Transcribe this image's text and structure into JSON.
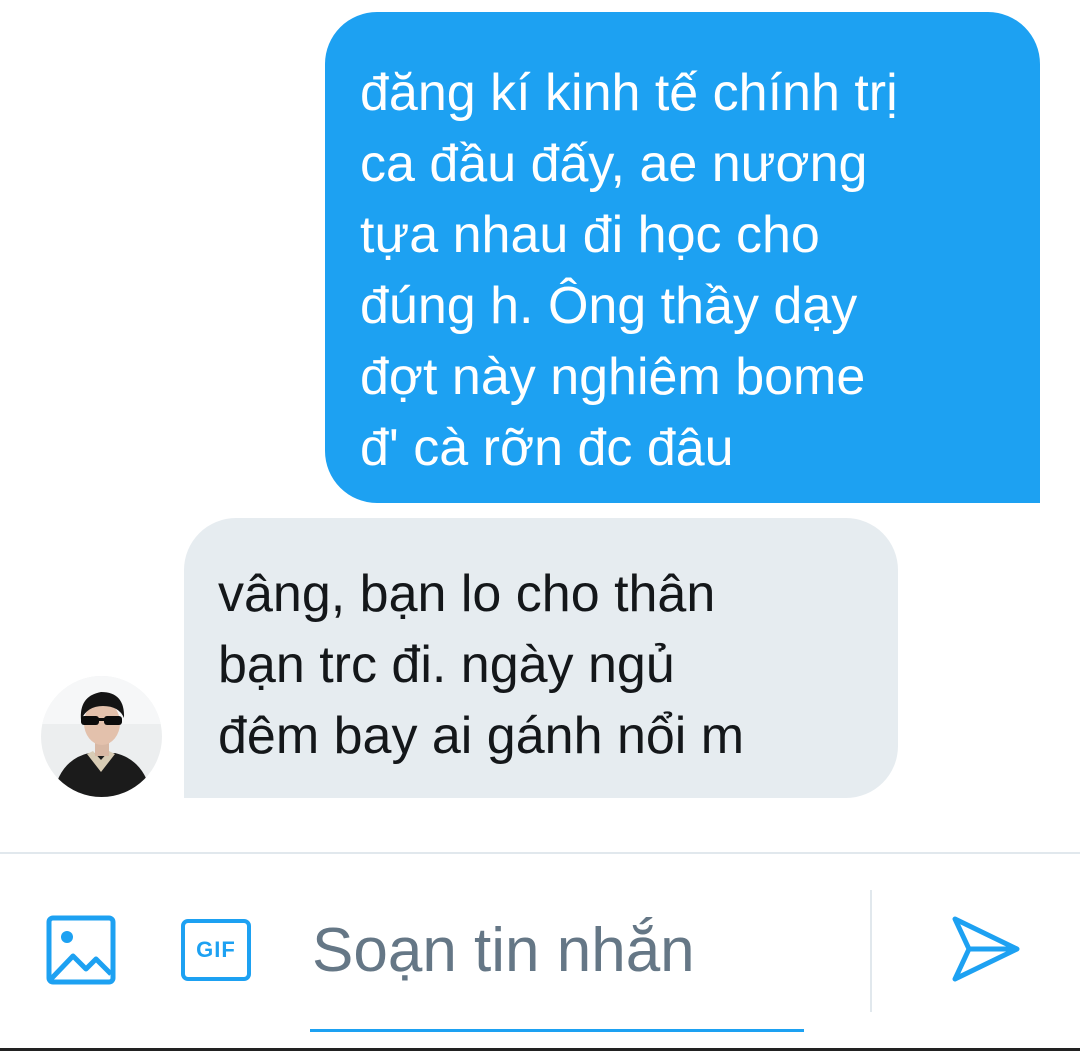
{
  "conversation": {
    "messages": [
      {
        "direction": "outgoing",
        "text": "đăng kí kinh tế chính trị\nca đầu đấy, ae nương\ntựa nhau đi học cho\nđúng h. Ông thầy dạy\nđợt này nghiêm bome\nđ' cà rỡn đc đâu"
      },
      {
        "direction": "incoming",
        "text": "vâng, bạn lo cho thân\nbạn trc đi. ngày ngủ\nđêm bay ai gánh nổi m"
      }
    ]
  },
  "composer": {
    "placeholder": "Soạn tin nhắn",
    "value": "",
    "gif_label": "GIF",
    "icons": {
      "image": "image-icon",
      "gif": "gif-icon",
      "send": "send-icon"
    }
  },
  "colors": {
    "accent": "#1da1f2",
    "incoming_bubble": "#e6ecf0",
    "outgoing_text": "#ffffff",
    "incoming_text": "#14171a",
    "placeholder": "#657786"
  }
}
